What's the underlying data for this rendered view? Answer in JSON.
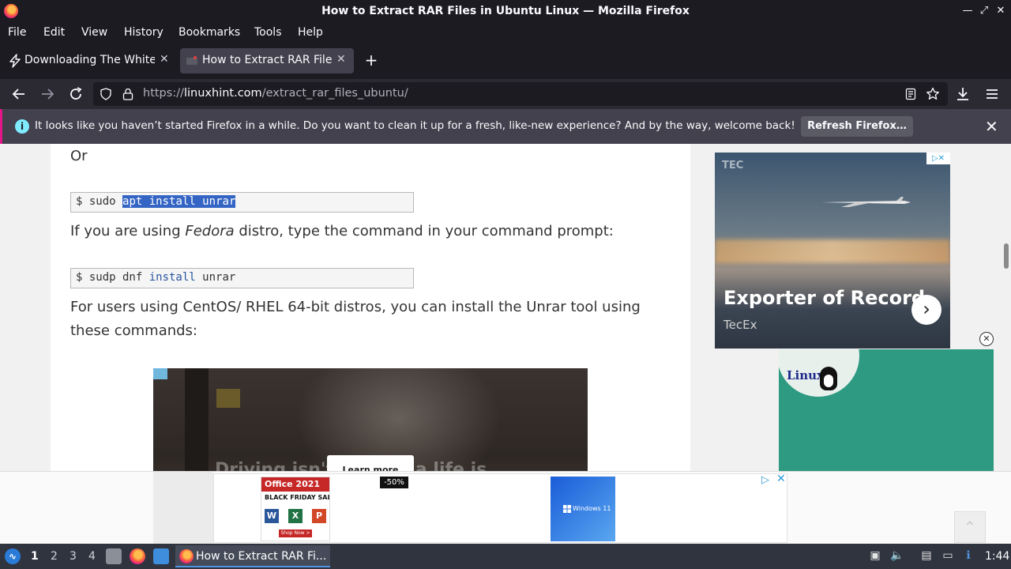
{
  "window": {
    "title": "How to Extract RAR Files in Ubuntu Linux — Mozilla Firefox",
    "minimize": "—",
    "maximize": "⤢",
    "close": "✕"
  },
  "menu": [
    "File",
    "Edit",
    "View",
    "History",
    "Bookmarks",
    "Tools",
    "Help"
  ],
  "tabs": [
    {
      "label": "Downloading The White",
      "close": "✕",
      "active": false
    },
    {
      "label": "How to Extract RAR Files",
      "close": "✕",
      "active": true
    }
  ],
  "new_tab": "+",
  "nav": {
    "url_prefix": "https://",
    "url_host": "linuxhint.com",
    "url_path": "/extract_rar_files_ubuntu/"
  },
  "notification": {
    "message": "It looks like you haven’t started Firefox in a while. Do you want to clean it up for a fresh, like-new experience? And by the way, welcome back!",
    "button": "Refresh Firefox…",
    "close": "✕"
  },
  "article": {
    "or_text": "Or",
    "code1": {
      "prompt": "$ sudo ",
      "selected": "apt install unrar"
    },
    "fedora_pre": "If you are using ",
    "fedora_em": "Fedora",
    "fedora_post": " distro, type the command in your command prompt:",
    "code2": {
      "prompt": "$ sudp dnf ",
      "kw": "install",
      "rest": " unrar"
    },
    "centos_line1": "For users using CentOS/ RHEL 64-bit distros, you can install the Unrar tool using",
    "centos_line2": "these commands:"
  },
  "video_ad": {
    "learn_more": "Learn more",
    "overlay_text": "Driving isn't driving a life is"
  },
  "sidebar_ad": {
    "brand": "TEC",
    "headline": "Exporter of Record",
    "advertiser": "TecEx",
    "adchoice": "▷✕",
    "arrow": "›"
  },
  "linux_ad": {
    "logo": "Linux"
  },
  "close_ad": "✕",
  "bottom_ad": {
    "office_title": "Office 2021",
    "office_sale": "BLACK FRIDAY SALE",
    "shop_now": "Shop Now >",
    "discount": "-50%",
    "windows_label": "Windows 11",
    "adchoice": "▷",
    "close": "✕",
    "scroll_top": "⌃"
  },
  "taskbar": {
    "workspaces": [
      "1",
      "2",
      "3",
      "4"
    ],
    "active_task": "How to Extract RAR Fi...",
    "clock": "1:44"
  }
}
